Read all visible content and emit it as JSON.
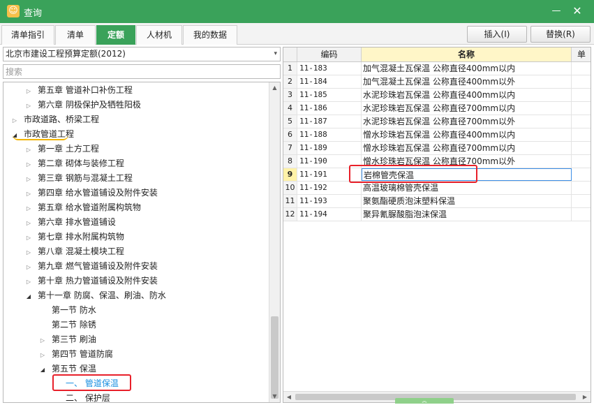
{
  "window": {
    "title": "查询",
    "app_icon": "☺",
    "minimize": "—",
    "close": "✕"
  },
  "tabs": [
    {
      "label": "清单指引",
      "active": false
    },
    {
      "label": "清单",
      "active": false
    },
    {
      "label": "定额",
      "active": true
    },
    {
      "label": "人材机",
      "active": false
    },
    {
      "label": "我的数据",
      "active": false
    }
  ],
  "actions": {
    "insert": "插入(I)",
    "replace": "替换(R)"
  },
  "library": {
    "selected": "北京市建设工程预算定额(2012)"
  },
  "search": {
    "placeholder": "搜索"
  },
  "tree": [
    {
      "label": "第五章 管道补口补伤工程",
      "level": 2,
      "state": "collapsed"
    },
    {
      "label": "第六章 阴极保护及牺牲阳极",
      "level": 2,
      "state": "collapsed"
    },
    {
      "label": "市政道路、桥梁工程",
      "level": 1,
      "state": "collapsed"
    },
    {
      "label": "市政管道工程",
      "level": 1,
      "state": "expanded"
    },
    {
      "label": "第一章 土方工程",
      "level": 2,
      "state": "collapsed"
    },
    {
      "label": "第二章 砌体与装修工程",
      "level": 2,
      "state": "collapsed"
    },
    {
      "label": "第三章 钢筋与混凝土工程",
      "level": 2,
      "state": "collapsed"
    },
    {
      "label": "第四章 给水管道铺设及附件安装",
      "level": 2,
      "state": "collapsed"
    },
    {
      "label": "第五章 给水管道附属构筑物",
      "level": 2,
      "state": "collapsed"
    },
    {
      "label": "第六章 排水管道铺设",
      "level": 2,
      "state": "collapsed"
    },
    {
      "label": "第七章 排水附属构筑物",
      "level": 2,
      "state": "collapsed"
    },
    {
      "label": "第八章 混凝土模块工程",
      "level": 2,
      "state": "collapsed"
    },
    {
      "label": "第九章 燃气管道铺设及附件安装",
      "level": 2,
      "state": "collapsed"
    },
    {
      "label": "第十章 热力管道铺设及附件安装",
      "level": 2,
      "state": "collapsed"
    },
    {
      "label": "第十一章 防腐、保温、刷油、防水",
      "level": 2,
      "state": "expanded"
    },
    {
      "label": "第一节 防水",
      "level": 3,
      "state": "leaf"
    },
    {
      "label": "第二节 除锈",
      "level": 3,
      "state": "leaf"
    },
    {
      "label": "第三节 刷油",
      "level": 3,
      "state": "collapsed"
    },
    {
      "label": "第四节 管道防腐",
      "level": 3,
      "state": "collapsed"
    },
    {
      "label": "第五节 保温",
      "level": 3,
      "state": "expanded"
    },
    {
      "label": "一、 管道保温",
      "level": 4,
      "state": "leaf",
      "selected": true
    },
    {
      "label": "二、 保护层",
      "level": 4,
      "state": "leaf"
    }
  ],
  "grid": {
    "columns": [
      "编码",
      "名称",
      "单"
    ],
    "rows": [
      {
        "no": "1",
        "code": "11-183",
        "name": "加气混凝土瓦保温 公称直径400mm以内"
      },
      {
        "no": "2",
        "code": "11-184",
        "name": "加气混凝土瓦保温 公称直径400mm以外"
      },
      {
        "no": "3",
        "code": "11-185",
        "name": "水泥珍珠岩瓦保温 公称直径400mm以内"
      },
      {
        "no": "4",
        "code": "11-186",
        "name": "水泥珍珠岩瓦保温 公称直径700mm以内"
      },
      {
        "no": "5",
        "code": "11-187",
        "name": "水泥珍珠岩瓦保温 公称直径700mm以外"
      },
      {
        "no": "6",
        "code": "11-188",
        "name": "憎水珍珠岩瓦保温 公称直径400mm以内"
      },
      {
        "no": "7",
        "code": "11-189",
        "name": "憎水珍珠岩瓦保温 公称直径700mm以内"
      },
      {
        "no": "8",
        "code": "11-190",
        "name": "憎水珍珠岩瓦保温 公称直径700mm以外"
      },
      {
        "no": "9",
        "code": "11-191",
        "name": "岩棉管壳保温",
        "current": true
      },
      {
        "no": "10",
        "code": "11-192",
        "name": "高温玻璃棉管壳保温"
      },
      {
        "no": "11",
        "code": "11-193",
        "name": "聚氨酯硬质泡沫塑料保温"
      },
      {
        "no": "12",
        "code": "11-194",
        "name": "聚异氰脲酸脂泡沫保温"
      }
    ]
  },
  "icons": {
    "collapsed": "▷",
    "expanded": "◢",
    "scroll_up": "▲",
    "scroll_down": "▼",
    "scroll_left": "◀",
    "scroll_right": "▶",
    "dropdown": "▾",
    "collapse_handle": "︽"
  },
  "colors": {
    "accent": "#3aa25a",
    "selection": "#1a8fe0",
    "annotation_red": "#e8202a",
    "annotation_yellow": "#f2b400"
  }
}
